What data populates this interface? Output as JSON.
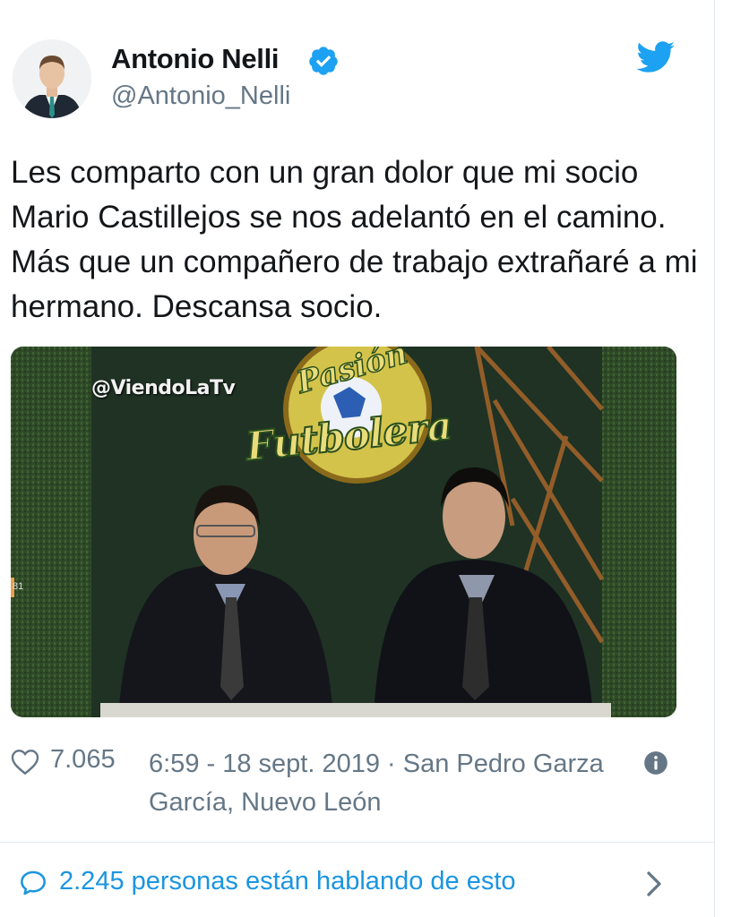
{
  "tweet": {
    "author_name": "Antonio Nelli",
    "handle": "@Antonio_Nelli",
    "verified": true,
    "text": "Les comparto con un gran dolor que mi socio Mario Castillejos se nos adelantó en el camino. Más que un compañero de trabajo extrañaré a mi hermano. Descansa socio.",
    "media": {
      "watermark": "@ViendoLaTv",
      "logo_top": "Pasión",
      "logo_bottom": "Futbolera",
      "channel_number": "81"
    },
    "likes": "7.065",
    "timestamp_location": "6:59 - 18 sept. 2019 · San Pedro Garza García, Nuevo León",
    "conversation": "2.245 personas están hablando de esto"
  },
  "icons": {
    "verified": "verified-badge-icon",
    "brand": "twitter-bird-icon",
    "like": "heart-icon",
    "info": "info-icon",
    "reply": "speech-bubble-icon",
    "chevron": "chevron-right-icon"
  },
  "colors": {
    "twitter_blue": "#1da1f2",
    "link_blue": "#1b95e0",
    "secondary_text": "#657786",
    "primary_text": "#14171a"
  }
}
